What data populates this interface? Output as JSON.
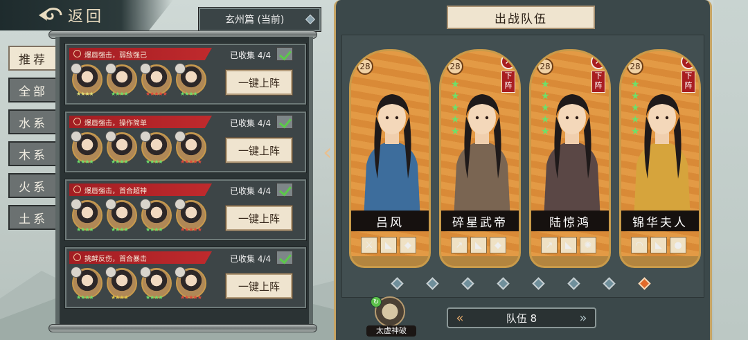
{
  "back": {
    "label": "返回",
    "icon": "back-swirl-icon"
  },
  "chapter": {
    "label": "玄州篇 (当前)"
  },
  "tabs": [
    {
      "label": "推荐",
      "active": true
    },
    {
      "label": "全部",
      "active": false
    },
    {
      "label": "水系",
      "active": false
    },
    {
      "label": "木系",
      "active": false
    },
    {
      "label": "火系",
      "active": false
    },
    {
      "label": "土系",
      "active": false
    }
  ],
  "teams": [
    {
      "ribbon": "爆唇强击，弱敌强己",
      "collected": "已收集 4/4",
      "button": "一键上阵",
      "heroes": [
        {
          "stars": "★★★★",
          "star_color": "#e0e07a"
        },
        {
          "stars": "★★★★",
          "star_color": "#6ee06a"
        },
        {
          "stars": "★★★★★",
          "star_color": "#e04a3a"
        },
        {
          "stars": "★★★★",
          "star_color": "#6ee06a"
        }
      ]
    },
    {
      "ribbon": "爆唇强击，操作简单",
      "collected": "已收集 4/4",
      "button": "一键上阵",
      "heroes": [
        {
          "stars": "★★★★",
          "star_color": "#6ee06a"
        },
        {
          "stars": "★★★★",
          "star_color": "#6ee06a"
        },
        {
          "stars": "★★★★",
          "star_color": "#6ee06a"
        },
        {
          "stars": "★★★★★",
          "star_color": "#e04a3a"
        }
      ]
    },
    {
      "ribbon": "爆唇强击，首合超神",
      "collected": "已收集 4/4",
      "button": "一键上阵",
      "heroes": [
        {
          "stars": "★★★★",
          "star_color": "#6ee06a"
        },
        {
          "stars": "★★★★",
          "star_color": "#6ee06a"
        },
        {
          "stars": "★★★★",
          "star_color": "#6ee06a"
        },
        {
          "stars": "★★★★★",
          "star_color": "#e04a3a"
        }
      ]
    },
    {
      "ribbon": "挑衅反伤，首合暴击",
      "collected": "已收集 4/4",
      "button": "一键上阵",
      "heroes": [
        {
          "stars": "★★★★",
          "star_color": "#6ee06a"
        },
        {
          "stars": "★★★★",
          "star_color": "#e0c84a"
        },
        {
          "stars": "★★★★",
          "star_color": "#6ee06a"
        },
        {
          "stars": "★★★★★",
          "star_color": "#e04a3a"
        }
      ]
    }
  ],
  "deploy": {
    "title": "出战队伍",
    "characters": [
      {
        "name": "吕风",
        "level": "28",
        "removable": false,
        "stars": 0,
        "items": [
          "sword-icon",
          "boots-icon",
          "armor-icon"
        ],
        "robe": "#3d6d9c"
      },
      {
        "name": "碎星武帝",
        "level": "28",
        "removable": true,
        "remove_label": "下阵",
        "stars": 5,
        "items": [
          "spear-icon",
          "boots-icon",
          "armor-icon"
        ],
        "robe": "#7a6552"
      },
      {
        "name": "陆惊鸿",
        "level": "28",
        "removable": true,
        "remove_label": "下阵",
        "stars": 5,
        "items": [
          "spear-icon",
          "boots-icon",
          "beast-icon"
        ],
        "robe": "#5a4745"
      },
      {
        "name": "锦华夫人",
        "level": "28",
        "removable": true,
        "remove_label": "下阵",
        "stars": 5,
        "items": [
          "fan-icon",
          "boots-icon",
          "gourd-icon"
        ],
        "robe": "#d6a43c"
      }
    ],
    "pager": {
      "count": 8,
      "active": 7
    },
    "skill": {
      "label": "太虚神破",
      "icon": "refresh-icon"
    },
    "team_switch": {
      "label": "队伍 8",
      "prev": "«",
      "next": "»"
    },
    "side_arrow": "‹"
  }
}
